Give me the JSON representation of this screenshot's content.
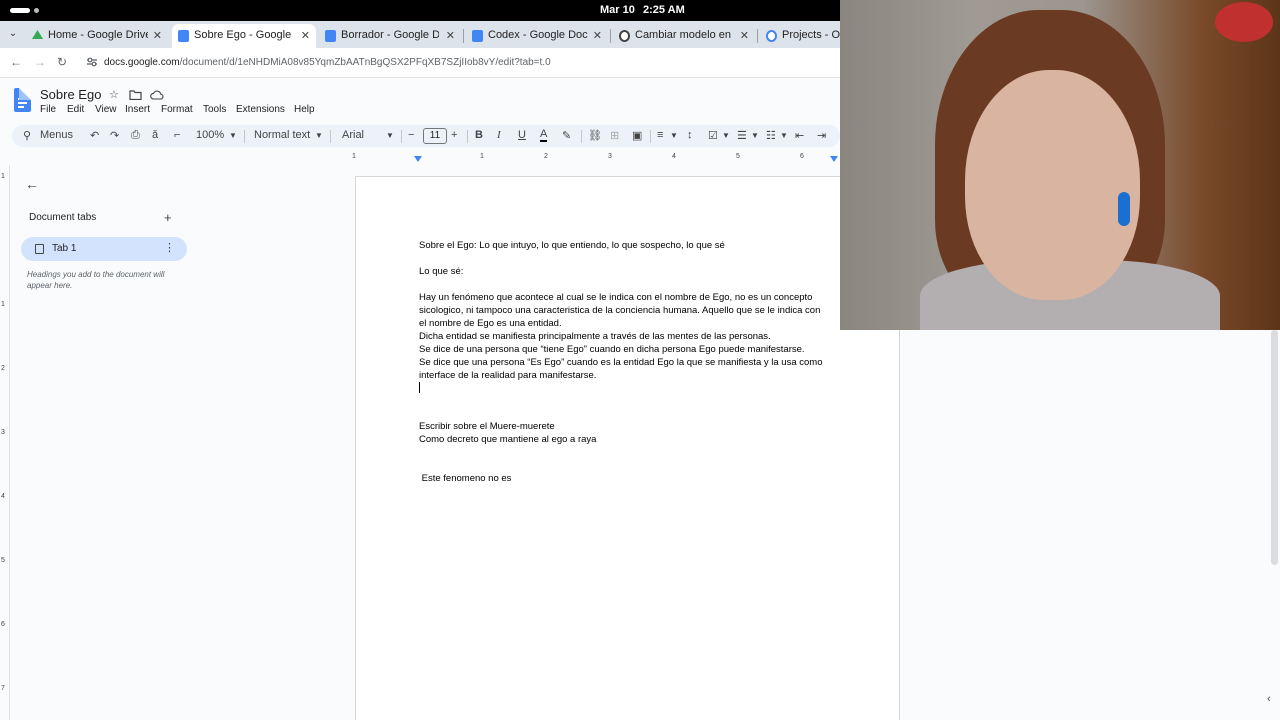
{
  "system": {
    "date": "Mar 10",
    "time": "2:25 AM"
  },
  "browser": {
    "tabs": [
      {
        "title": "Home - Google Drive",
        "favicon_color": "#34a853",
        "active": false
      },
      {
        "title": "Sobre Ego - Google Docs",
        "favicon_color": "#4285f4",
        "active": true
      },
      {
        "title": "Borrador - Google Docs",
        "favicon_color": "#4285f4",
        "active": false
      },
      {
        "title": "Codex - Google Docs",
        "favicon_color": "#4285f4",
        "active": false
      },
      {
        "title": "Cambiar modelo en Codex",
        "favicon_color": "#444444",
        "active": false
      },
      {
        "title": "Projects - Op",
        "favicon_color": "#4285f4",
        "active": false
      }
    ],
    "url_host": "docs.google.com",
    "url_path": "/document/d/1eNHDMiA08v85YqmZbAATnBgQSX2PFqXB7SZjIIob8vY/edit?tab=t.0"
  },
  "docs": {
    "title": "Sobre Ego",
    "menu": [
      "File",
      "Edit",
      "View",
      "Insert",
      "Format",
      "Tools",
      "Extensions",
      "Help"
    ],
    "toolbar": {
      "menus_label": "Menus",
      "zoom": "100%",
      "style": "Normal text",
      "font": "Arial",
      "font_size": "11"
    },
    "ruler_numbers": [
      "1",
      "1",
      "2",
      "3",
      "4",
      "5",
      "6"
    ],
    "vruler_numbers": [
      "1",
      "1",
      "2",
      "3",
      "4",
      "5",
      "6",
      "7"
    ]
  },
  "side_panel": {
    "heading": "Document tabs",
    "tab_label": "Tab 1",
    "hint": "Headings you add to the document will appear here."
  },
  "document": {
    "lines": [
      "Sobre el Ego: Lo que intuyo, lo que entiendo, lo que sospecho, lo que sé",
      "Lo que sé:",
      "Hay un fenómeno que acontece al cual se le indica con el nombre de Ego, no es un concepto",
      "sicologico, ni tampoco una caracteristica de la conciencia humana. Aquello que se le indica con",
      "el nombre de Ego es una entidad.",
      "Dicha entidad se manifiesta principalmente a través de las mentes de las personas.",
      "Se dice de una persona que “tiene Ego” cuando en dicha persona Ego puede manifestarse.",
      "Se dice que una persona “Es Ego” cuando es la entidad Ego la que se manifiesta y la usa como",
      "interface de la realidad para manifestarse.",
      "Escribir sobre el  Muere-muerete",
      "Como decreto que mantiene al ego a raya",
      " Este fenomeno no es"
    ]
  }
}
